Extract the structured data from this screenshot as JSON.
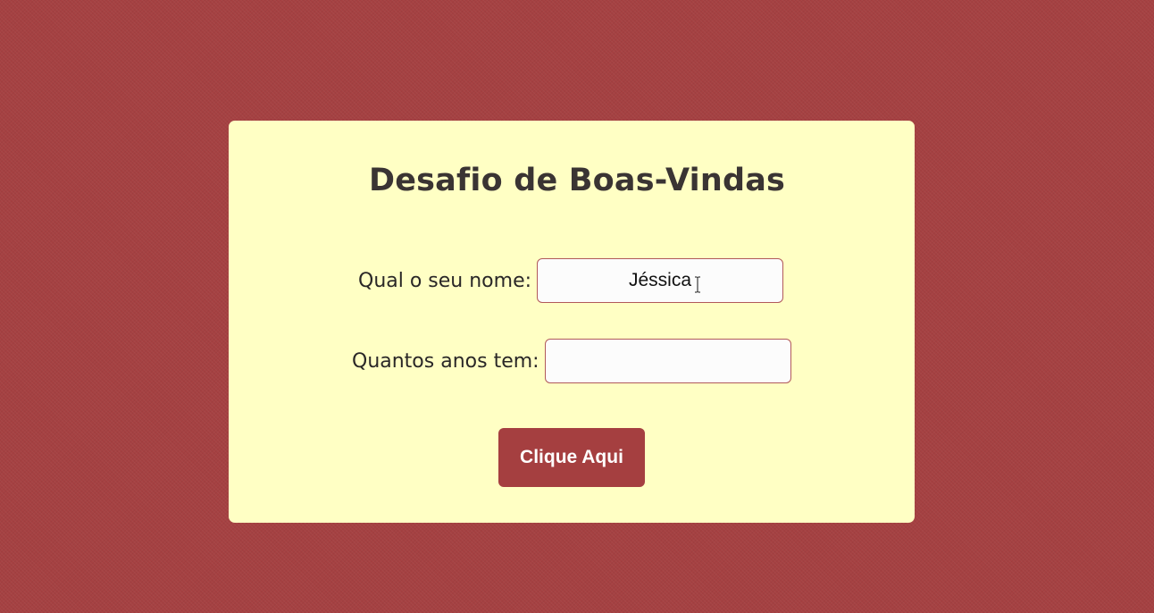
{
  "page": {
    "background_color": "#a54142",
    "card_color": "#ffffc4",
    "accent_color": "#a53f40"
  },
  "form": {
    "title": "Desafio de Boas-Vindas",
    "name": {
      "label": "Qual o seu nome:",
      "value": "Jéssica",
      "placeholder": ""
    },
    "age": {
      "label": "Quantos anos tem:",
      "value": "",
      "placeholder": ""
    },
    "submit_label": "Clique Aqui"
  },
  "cursor": {
    "icon": "text-cursor-icon"
  }
}
